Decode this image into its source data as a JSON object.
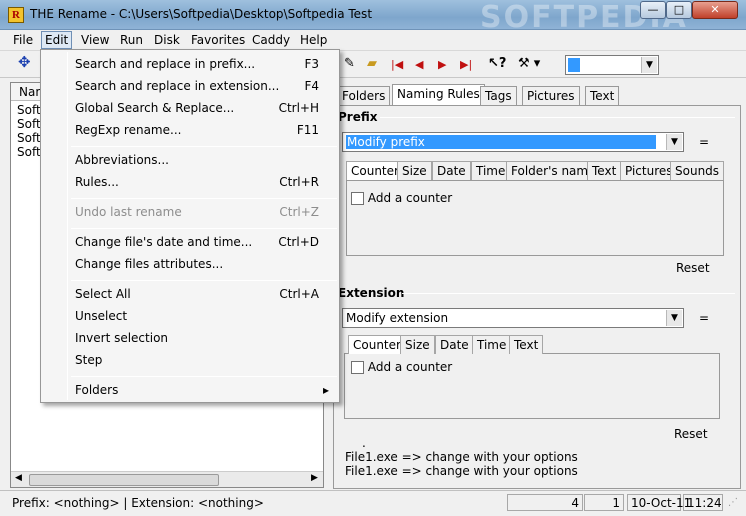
{
  "window": {
    "title": "THE Rename - C:\\Users\\Softpedia\\Desktop\\Softpedia Test",
    "watermark": "SOFTPEDIA",
    "icon_letter": "R",
    "controls": {
      "minimize": "—",
      "maximize": "□",
      "close": "✕"
    }
  },
  "menubar": [
    "File",
    "Edit",
    "View",
    "Run",
    "Disk",
    "Favorites",
    "Caddy",
    "Help"
  ],
  "toolbar": {
    "icons": [
      "move-arrows-icon",
      "pen-icon",
      "eraser-icon",
      "first-icon",
      "prev-icon",
      "next-icon",
      "last-icon",
      "help-cursor-icon",
      "tools-icon"
    ]
  },
  "file_list": {
    "header": "Nam",
    "rows": [
      "Softp",
      "Softp",
      "Softp",
      "Softp"
    ]
  },
  "tabs": [
    "Folders",
    "Naming Rules",
    "Tags",
    "Pictures",
    "Text"
  ],
  "prefix": {
    "title": "Prefix",
    "combo_value": "Modify prefix",
    "equals": "=",
    "subtabs": [
      "Counter",
      "Size",
      "Date",
      "Time",
      "Folder's name",
      "Text",
      "Pictures",
      "Sounds"
    ],
    "checkbox_label": "Add a counter",
    "reset": "Reset"
  },
  "extension": {
    "title": "Extension",
    "combo_value": "Modify extension",
    "equals": "=",
    "subtabs": [
      "Counter",
      "Size",
      "Date",
      "Time",
      "Text"
    ],
    "checkbox_label": "Add a counter",
    "reset": "Reset"
  },
  "preview": {
    "dot": ".",
    "line1": "File1.exe => change with your options",
    "line2": "File1.exe => change with your options"
  },
  "edit_menu": [
    {
      "label": "Search and replace in prefix...",
      "shortcut": "F3"
    },
    {
      "label": "Search and replace in extension...",
      "shortcut": "F4"
    },
    {
      "label": "Global Search & Replace...",
      "shortcut": "Ctrl+H"
    },
    {
      "label": "RegExp rename...",
      "shortcut": "F11"
    },
    {
      "label": "Abbreviations...",
      "shortcut": ""
    },
    {
      "label": "Rules...",
      "shortcut": "Ctrl+R"
    },
    {
      "label": "Undo last rename",
      "shortcut": "Ctrl+Z"
    },
    {
      "label": "Change file's date and time...",
      "shortcut": "Ctrl+D"
    },
    {
      "label": "Change files attributes...",
      "shortcut": ""
    },
    {
      "label": "Select All",
      "shortcut": "Ctrl+A"
    },
    {
      "label": "Unselect",
      "shortcut": ""
    },
    {
      "label": "Invert selection",
      "shortcut": ""
    },
    {
      "label": "Step",
      "shortcut": ""
    },
    {
      "label": "Folders",
      "shortcut": "▸"
    }
  ],
  "statusbar": {
    "text": "Prefix: <nothing> | Extension: <nothing>",
    "count1": "4",
    "count2": "1",
    "date": "10-Oct-11",
    "time": "11:24"
  },
  "colors": {
    "selection": "#3399ff",
    "titlebar": "#8fb3d6"
  }
}
